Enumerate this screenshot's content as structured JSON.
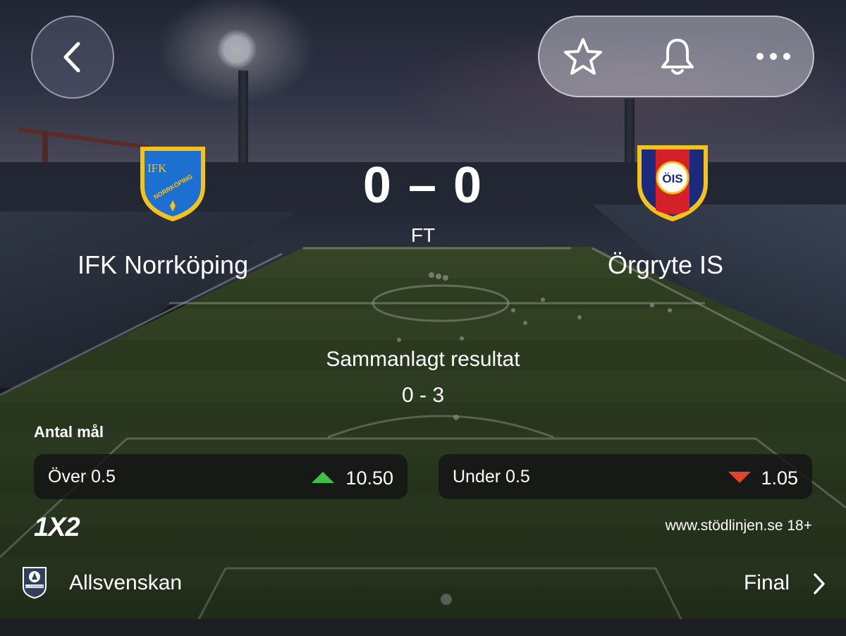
{
  "header": {
    "back_icon": "chevron-left-icon",
    "actions": [
      {
        "name": "favorite",
        "icon": "star-icon"
      },
      {
        "name": "notifications",
        "icon": "bell-icon"
      },
      {
        "name": "more",
        "icon": "more-horizontal-icon"
      }
    ]
  },
  "match": {
    "home_team": "IFK Norrköping",
    "away_team": "Örgryte IS",
    "score": "0 – 0",
    "status": "FT",
    "aggregate_label": "Sammanlagt resultat",
    "aggregate_score": "0 - 3"
  },
  "home_logo": {
    "text_top": "IFK",
    "text_arc": "NORRKÖPING",
    "colors": {
      "fill": "#1d6fd0",
      "border": "#f3c21b"
    }
  },
  "away_logo": {
    "text": "ÖIS",
    "colors": {
      "blue": "#1b2a7a",
      "red": "#d42027",
      "border": "#f3c21b"
    }
  },
  "market": {
    "title": "Antal mål",
    "options": [
      {
        "label": "Över 0.5",
        "odds": "10.50",
        "trend": "up",
        "trend_color": "#3fbf4a"
      },
      {
        "label": "Under 0.5",
        "odds": "1.05",
        "trend": "down",
        "trend_color": "#e2442d"
      }
    ]
  },
  "bookmaker": {
    "name": "1X2"
  },
  "responsible_gambling": "www.stödlinjen.se 18+",
  "league": {
    "name": "Allsvenskan",
    "round": "Final",
    "icon": "allsvenskan-logo-icon",
    "badge_text": "ALLSVENSKAN"
  }
}
